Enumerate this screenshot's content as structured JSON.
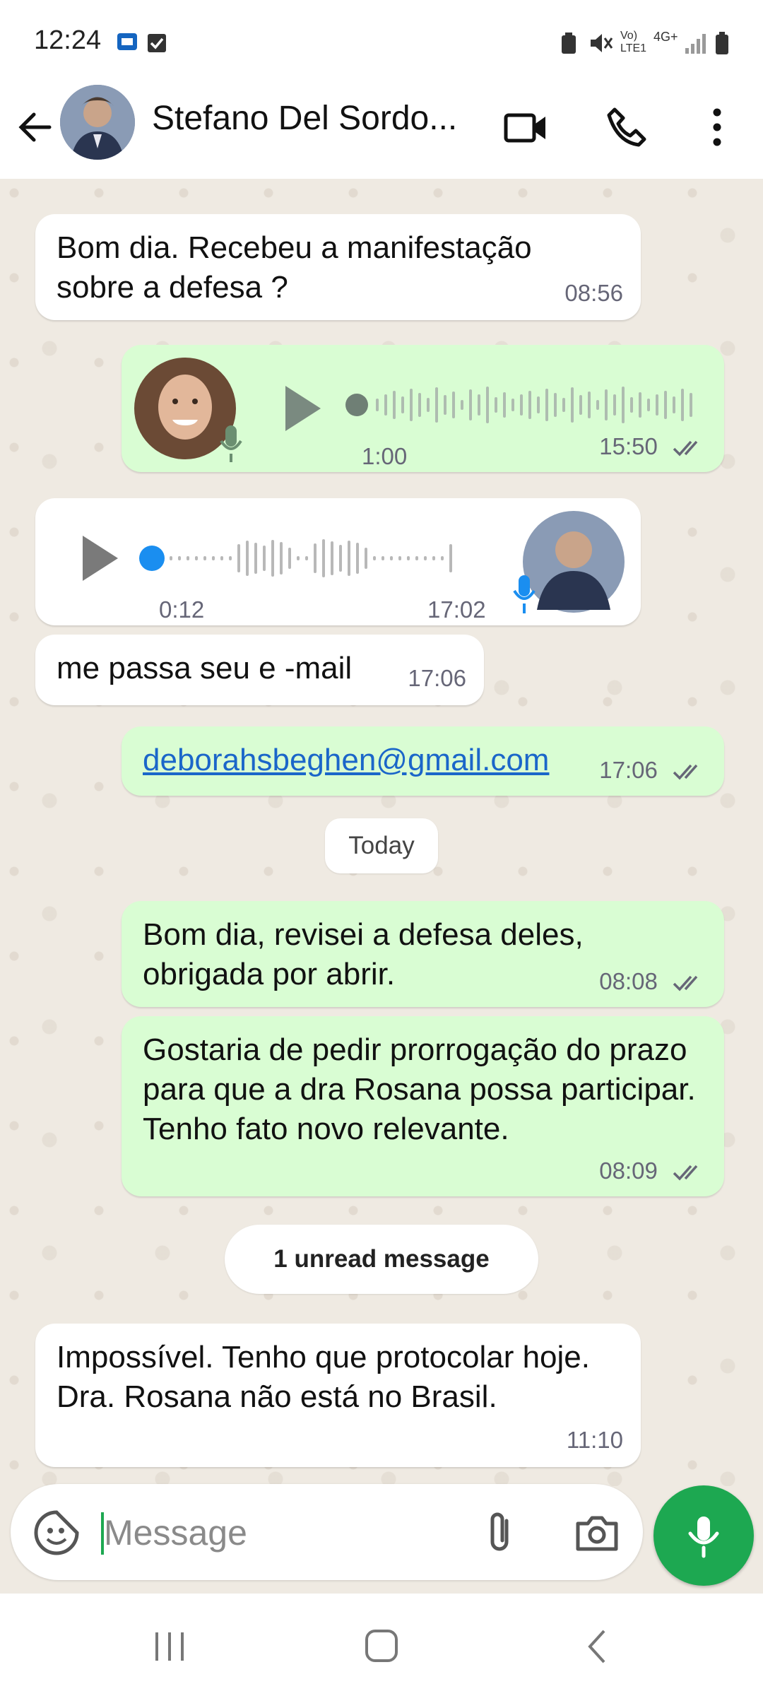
{
  "status_bar": {
    "time": "12:24",
    "network": "Vo) LTE1",
    "signal": "4G+"
  },
  "header": {
    "contact_name": "Stefano Del Sordo...",
    "back_icon": "arrow-left-icon",
    "video_icon": "video-camera-icon",
    "call_icon": "phone-icon",
    "menu_icon": "more-vertical-icon"
  },
  "messages": [
    {
      "text": "Bom dia. Recebeu a manifestação sobre a defesa ?",
      "time": "08:56",
      "direction": "in"
    },
    {
      "type": "voice",
      "duration": "1:00",
      "time": "15:50",
      "direction": "out"
    },
    {
      "type": "voice",
      "duration": "0:12",
      "time": "17:02",
      "direction": "in"
    },
    {
      "text": "me passa seu e -mail",
      "time": "17:06",
      "direction": "in"
    },
    {
      "text": "deborahsbeghen@gmail.com",
      "time": "17:06",
      "direction": "out"
    },
    {
      "text": "Bom dia, revisei a defesa deles, obrigada por abrir.",
      "time": "08:08",
      "direction": "out"
    },
    {
      "text": "Gostaria de pedir prorrogação do prazo para que a dra Rosana possa participar. Tenho fato novo relevante.",
      "time": "08:09",
      "direction": "out"
    },
    {
      "text": "Impossível. Tenho que protocolar hoje. Dra. Rosana não está no Brasil.",
      "time": "11:10",
      "direction": "in"
    }
  ],
  "separators": {
    "today": "Today",
    "unread": "1 unread message"
  },
  "composer": {
    "placeholder": "Message"
  },
  "colors": {
    "outgoing": "#d9fdd3",
    "incoming": "#ffffff",
    "accent": "#1da851",
    "link": "#1b66c9",
    "tick": "#53bdeb"
  }
}
